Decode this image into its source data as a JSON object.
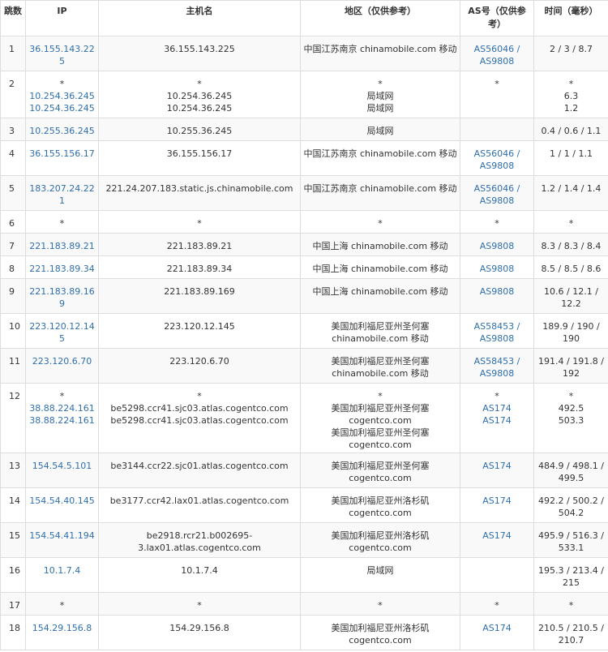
{
  "colors": {
    "link": "#2f6fae",
    "border": "#dddddd",
    "stripe": "#f9f9f9",
    "text": "#333333"
  },
  "headers": {
    "hop": "跳数",
    "ip": "IP",
    "host": "主机名",
    "region": "地区（仅供参考）",
    "as": "AS号（仅供参考）",
    "time": "时间（毫秒）"
  },
  "rows": [
    {
      "hop": "1",
      "ip": [
        "36.155.143.225"
      ],
      "host": [
        "36.155.143.225"
      ],
      "region": [
        "中国江苏南京 chinamobile.com 移动"
      ],
      "as": [
        "AS56046 / AS9808"
      ],
      "time": [
        "2 / 3 / 8.7"
      ]
    },
    {
      "hop": "2",
      "ip": [
        "*",
        "10.254.36.245",
        "10.254.36.245"
      ],
      "host": [
        "*",
        "10.254.36.245",
        "10.254.36.245"
      ],
      "region": [
        "*",
        "局域网",
        "局域网"
      ],
      "as": [
        "*"
      ],
      "time": [
        "*",
        "6.3",
        "1.2"
      ]
    },
    {
      "hop": "3",
      "ip": [
        "10.255.36.245"
      ],
      "host": [
        "10.255.36.245"
      ],
      "region": [
        "局域网"
      ],
      "as": [],
      "time": [
        "0.4 / 0.6 / 1.1"
      ]
    },
    {
      "hop": "4",
      "ip": [
        "36.155.156.17"
      ],
      "host": [
        "36.155.156.17"
      ],
      "region": [
        "中国江苏南京 chinamobile.com 移动"
      ],
      "as": [
        "AS56046 / AS9808"
      ],
      "time": [
        "1 / 1 / 1.1"
      ]
    },
    {
      "hop": "5",
      "ip": [
        "183.207.24.221"
      ],
      "host": [
        "221.24.207.183.static.js.chinamobile.com"
      ],
      "region": [
        "中国江苏南京 chinamobile.com 移动"
      ],
      "as": [
        "AS56046 / AS9808"
      ],
      "time": [
        "1.2 / 1.4 / 1.4"
      ]
    },
    {
      "hop": "6",
      "ip": [
        "*"
      ],
      "host": [
        "*"
      ],
      "region": [
        "*"
      ],
      "as": [
        "*"
      ],
      "time": [
        "*"
      ]
    },
    {
      "hop": "7",
      "ip": [
        "221.183.89.21"
      ],
      "host": [
        "221.183.89.21"
      ],
      "region": [
        "中国上海 chinamobile.com 移动"
      ],
      "as": [
        "AS9808"
      ],
      "time": [
        "8.3 / 8.3 / 8.4"
      ]
    },
    {
      "hop": "8",
      "ip": [
        "221.183.89.34"
      ],
      "host": [
        "221.183.89.34"
      ],
      "region": [
        "中国上海 chinamobile.com 移动"
      ],
      "as": [
        "AS9808"
      ],
      "time": [
        "8.5 / 8.5 / 8.6"
      ]
    },
    {
      "hop": "9",
      "ip": [
        "221.183.89.169"
      ],
      "host": [
        "221.183.89.169"
      ],
      "region": [
        "中国上海 chinamobile.com 移动"
      ],
      "as": [
        "AS9808"
      ],
      "time": [
        "10.6 / 12.1 / 12.2"
      ]
    },
    {
      "hop": "10",
      "ip": [
        "223.120.12.145"
      ],
      "host": [
        "223.120.12.145"
      ],
      "region": [
        "美国加利福尼亚州圣何塞 chinamobile.com 移动"
      ],
      "as": [
        "AS58453 / AS9808"
      ],
      "time": [
        "189.9 / 190 / 190"
      ]
    },
    {
      "hop": "11",
      "ip": [
        "223.120.6.70"
      ],
      "host": [
        "223.120.6.70"
      ],
      "region": [
        "美国加利福尼亚州圣何塞 chinamobile.com 移动"
      ],
      "as": [
        "AS58453 / AS9808"
      ],
      "time": [
        "191.4 / 191.8 / 192"
      ]
    },
    {
      "hop": "12",
      "ip": [
        "*",
        "38.88.224.161",
        "38.88.224.161"
      ],
      "host": [
        "*",
        "be5298.ccr41.sjc03.atlas.cogentco.com",
        "be5298.ccr41.sjc03.atlas.cogentco.com"
      ],
      "region": [
        "*",
        "美国加利福尼亚州圣何塞 cogentco.com",
        "美国加利福尼亚州圣何塞 cogentco.com"
      ],
      "as": [
        "*",
        "AS174",
        "AS174"
      ],
      "time": [
        "*",
        "492.5",
        "503.3"
      ]
    },
    {
      "hop": "13",
      "ip": [
        "154.54.5.101"
      ],
      "host": [
        "be3144.ccr22.sjc01.atlas.cogentco.com"
      ],
      "region": [
        "美国加利福尼亚州圣何塞 cogentco.com"
      ],
      "as": [
        "AS174"
      ],
      "time": [
        "484.9 / 498.1 / 499.5"
      ]
    },
    {
      "hop": "14",
      "ip": [
        "154.54.40.145"
      ],
      "host": [
        "be3177.ccr42.lax01.atlas.cogentco.com"
      ],
      "region": [
        "美国加利福尼亚州洛杉矶 cogentco.com"
      ],
      "as": [
        "AS174"
      ],
      "time": [
        "492.2 / 500.2 / 504.2"
      ]
    },
    {
      "hop": "15",
      "ip": [
        "154.54.41.194"
      ],
      "host": [
        "be2918.rcr21.b002695-3.lax01.atlas.cogentco.com"
      ],
      "region": [
        "美国加利福尼亚州洛杉矶 cogentco.com"
      ],
      "as": [
        "AS174"
      ],
      "time": [
        "495.9 / 516.3 / 533.1"
      ]
    },
    {
      "hop": "16",
      "ip": [
        "10.1.7.4"
      ],
      "host": [
        "10.1.7.4"
      ],
      "region": [
        "局域网"
      ],
      "as": [],
      "time": [
        "195.3 / 213.4 / 215"
      ]
    },
    {
      "hop": "17",
      "ip": [
        "*"
      ],
      "host": [
        "*"
      ],
      "region": [
        "*"
      ],
      "as": [
        "*"
      ],
      "time": [
        "*"
      ]
    },
    {
      "hop": "18",
      "ip": [
        "154.29.156.8"
      ],
      "host": [
        "154.29.156.8"
      ],
      "region": [
        "美国加利福尼亚州洛杉矶 cogentco.com"
      ],
      "as": [
        "AS174"
      ],
      "time": [
        "210.5 / 210.5 / 210.7"
      ]
    }
  ]
}
